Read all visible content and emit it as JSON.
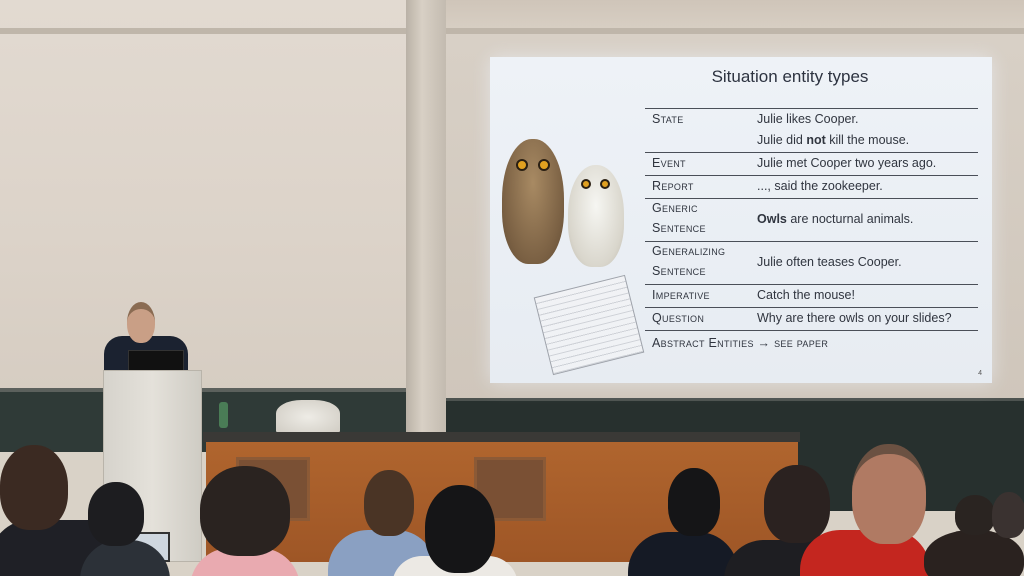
{
  "slide": {
    "title": "Situation entity types",
    "page_number": "4",
    "rows": [
      {
        "term": "State",
        "examples": [
          "Julie likes Cooper.",
          "Julie did not kill the mouse."
        ]
      },
      {
        "term": "Event",
        "examples": [
          "Julie met Cooper two years ago."
        ]
      },
      {
        "term": "Report",
        "examples": [
          "..., said the zookeeper."
        ]
      },
      {
        "term": "Generic Sentence",
        "term_lines": [
          "Generic",
          "Sentence"
        ],
        "examples": [
          "Owls are nocturnal animals."
        ]
      },
      {
        "term": "Generalizing Sentence",
        "term_lines": [
          "Generalizing",
          "Sentence"
        ],
        "examples": [
          "Julie often teases Cooper."
        ]
      },
      {
        "term": "Imperative",
        "examples": [
          "Catch the mouse!"
        ]
      },
      {
        "term": "Question",
        "examples": [
          "Why are there owls on your slides?"
        ]
      }
    ],
    "abstract_row": "Abstract Entities → see paper",
    "state_example2_parts": {
      "before": "Julie did ",
      "bold": "not",
      "after": " kill the mouse."
    },
    "generic_example_parts": {
      "bold": "Owls",
      "after": " are nocturnal animals."
    }
  },
  "colors": {
    "slide_bg": "#eef2f7",
    "wall": "#dcd3c9",
    "desk_wood": "#a85d29",
    "chalkboard": "#2b3432",
    "audience_red_shirt": "#c4261f"
  }
}
